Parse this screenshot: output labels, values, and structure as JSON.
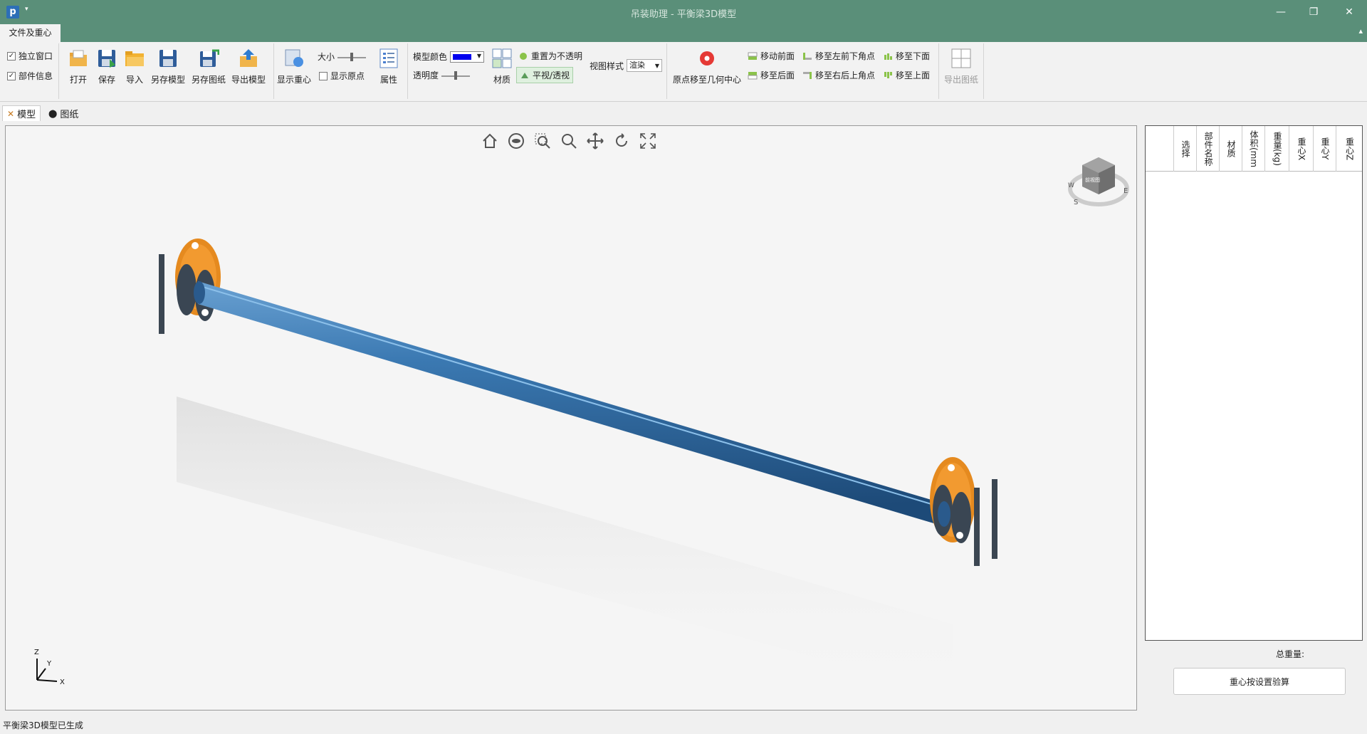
{
  "window": {
    "app_icon": "p",
    "title": "吊装助理 - 平衡梁3D模型",
    "minimize_icon": "minimize-icon",
    "restore_icon": "restore-icon",
    "close_icon": "close-icon"
  },
  "ribbon_tabs": [
    {
      "label": "文件及重心",
      "active": true
    }
  ],
  "ribbon": {
    "checkboxes": [
      {
        "label": "独立窗口",
        "checked": true
      },
      {
        "label": "部件信息",
        "checked": true
      }
    ],
    "file_buttons": [
      {
        "label": "打开",
        "icon": "open-folder-icon"
      },
      {
        "label": "保存",
        "icon": "save-icon"
      },
      {
        "label": "导入",
        "icon": "import-folder-icon"
      },
      {
        "label": "另存模型",
        "icon": "save-as-icon"
      },
      {
        "label": "另存图纸",
        "icon": "save-drawing-icon"
      },
      {
        "label": "导出模型",
        "icon": "export-model-icon"
      }
    ],
    "show_cog": "显示重心",
    "size_label": "大小",
    "show_origin": {
      "label": "显示原点",
      "checked": false
    },
    "properties": "属性",
    "model_color_label": "模型颜色",
    "model_color": "#0000ee",
    "transparency_label": "透明度",
    "material": "材质",
    "reset_opaque": "重置为不透明",
    "ortho_persp": "平视/透视",
    "view_style_label": "视图样式",
    "view_style_value": "渲染",
    "origin_to_center": "原点移至几何中心",
    "move_front": "移动前面",
    "move_back": "移至后面",
    "move_left_front_bottom": "移至左前下角点",
    "move_right_back_top": "移至右后上角点",
    "move_bottom": "移至下面",
    "move_top": "移至上面",
    "export_drawing": "导出图纸"
  },
  "doc_tabs": [
    {
      "label": "模型",
      "active": true,
      "icon": "model-icon"
    },
    {
      "label": "图纸",
      "active": false,
      "icon": "drawing-icon"
    }
  ],
  "viewport": {
    "toolbar_icons": [
      "home-icon",
      "view-icon",
      "zoom-window-icon",
      "zoom-icon",
      "pan-icon",
      "rotate-icon",
      "fit-screen-icon"
    ],
    "navcube_label": "前视图",
    "axes": {
      "z": "Z",
      "y": "Y",
      "x": "X"
    },
    "compass": {
      "s": "S",
      "e": "E",
      "w": "W"
    }
  },
  "parts_table": {
    "columns": [
      "选择",
      "部件名称",
      "材质",
      "体积(mm",
      "重量(kg)",
      "重心X",
      "重心Y",
      "重心Z"
    ],
    "rows": []
  },
  "total_weight_label": "总重量:",
  "calc_button": "重心按设置验算",
  "status": "平衡梁3D模型已生成",
  "colors": {
    "titlebar": "#5a8f79",
    "beam": "#2d6aa0",
    "plate": "#e58a1f"
  }
}
